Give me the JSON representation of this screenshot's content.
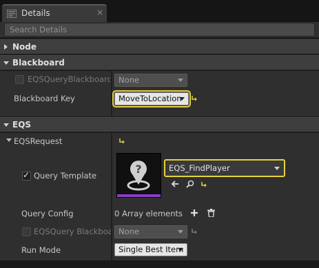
{
  "tab": {
    "title": "Details",
    "icon": "details-icon",
    "close_glyph": "×"
  },
  "search": {
    "placeholder": "Search Details",
    "value": ""
  },
  "categories": {
    "node": "Node",
    "blackboard": "Blackboard",
    "eqs": "EQS"
  },
  "blackboard": {
    "eqs_query_blackboard_key": {
      "label": "EQSQueryBlackboardKe",
      "value": "None",
      "enabled": false
    },
    "blackboard_key": {
      "label": "Blackboard Key",
      "value": "MoveToLocation",
      "highlighted": true
    }
  },
  "eqs": {
    "request_label": "EQSRequest",
    "query_template": {
      "label": "Query Template",
      "checked": true,
      "asset": "EQS_FindPlayer"
    },
    "query_config": {
      "label": "Query Config",
      "value": "0 Array elements"
    },
    "eqs_query_blackboard": {
      "label": "EQSQuery Blackboard",
      "value": "None",
      "enabled": false
    },
    "run_mode": {
      "label": "Run Mode",
      "value": "Single Best Item"
    }
  },
  "colors": {
    "highlight": "#e8d23a",
    "reset_arrow": "#e8d23a",
    "asset_bar": "#8a3cc8"
  }
}
